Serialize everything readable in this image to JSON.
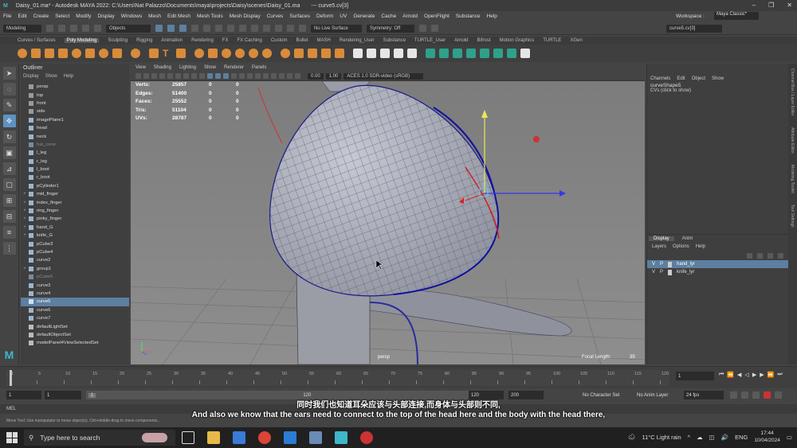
{
  "window": {
    "file": "Daisy_01.ma*",
    "title": "Autodesk MAYA 2022: C:\\Users\\Nat Palazzo\\Documents\\maya\\projects\\Daisy\\scenes\\Daisy_01.ma",
    "tail": "---   curve5.cv[3]"
  },
  "menubar": {
    "items": [
      "File",
      "Edit",
      "Create",
      "Select",
      "Modify",
      "Display",
      "Windows",
      "Mesh",
      "Edit Mesh",
      "Mesh Tools",
      "Mesh Display",
      "Curves",
      "Surfaces",
      "Deform",
      "UV",
      "Generate",
      "Cache",
      "Arnold",
      "OpenFlight",
      "Substance",
      "Help"
    ],
    "workspace_label": "Workspace :",
    "workspace_value": "Maya Classic*"
  },
  "statusline": {
    "menuset": "Modeling",
    "select_mode": "Objects",
    "live_surface": "No Live Surface",
    "symmetry": "Symmetry: Off",
    "name_field": "curve5.cv[3]"
  },
  "shelf_tabs": [
    "Curves / Surfaces",
    "Poly Modeling",
    "Sculpting",
    "Rigging",
    "Animation",
    "Rendering",
    "FX",
    "FX Caching",
    "Custom",
    "Bullet",
    "MASH",
    "Rendering_User",
    "Substance",
    "TURTLE_User",
    "Arnold",
    "Bifrost",
    "Motion Graphics",
    "TURTLE",
    "XGen"
  ],
  "shelf_active": "Poly Modeling",
  "outliner": {
    "title": "Outliner",
    "menu": [
      "Display",
      "Show",
      "Help"
    ],
    "items": [
      {
        "label": "persp",
        "exp": "",
        "dim": false,
        "sel": false,
        "color": "#9a9a9a"
      },
      {
        "label": "top",
        "exp": "",
        "dim": false,
        "sel": false,
        "color": "#9a9a9a"
      },
      {
        "label": "front",
        "exp": "",
        "dim": false,
        "sel": false,
        "color": "#9a9a9a"
      },
      {
        "label": "side",
        "exp": "",
        "dim": false,
        "sel": false,
        "color": "#9a9a9a"
      },
      {
        "label": "imagePlane1",
        "exp": "",
        "dim": false,
        "sel": false,
        "color": "#9ab5cf"
      },
      {
        "label": "head",
        "exp": "",
        "dim": false,
        "sel": false,
        "color": "#9ab5cf"
      },
      {
        "label": "neck",
        "exp": "",
        "dim": false,
        "sel": false,
        "color": "#9ab5cf"
      },
      {
        "label": "hat_cone",
        "exp": "",
        "dim": true,
        "sel": false,
        "color": "#7a8a9a"
      },
      {
        "label": "l_leg",
        "exp": "",
        "dim": false,
        "sel": false,
        "color": "#9ab5cf"
      },
      {
        "label": "r_leg",
        "exp": "",
        "dim": false,
        "sel": false,
        "color": "#9ab5cf"
      },
      {
        "label": "l_boot",
        "exp": "",
        "dim": false,
        "sel": false,
        "color": "#9ab5cf"
      },
      {
        "label": "r_boot",
        "exp": "",
        "dim": false,
        "sel": false,
        "color": "#9ab5cf"
      },
      {
        "label": "pCylinder1",
        "exp": "",
        "dim": false,
        "sel": false,
        "color": "#9ab5cf"
      },
      {
        "label": "mid_finger",
        "exp": "+",
        "dim": false,
        "sel": false,
        "color": "#9ab5cf"
      },
      {
        "label": "index_finger",
        "exp": "+",
        "dim": false,
        "sel": false,
        "color": "#9ab5cf"
      },
      {
        "label": "ring_finger",
        "exp": "+",
        "dim": false,
        "sel": false,
        "color": "#9ab5cf"
      },
      {
        "label": "pinky_finger",
        "exp": "+",
        "dim": false,
        "sel": false,
        "color": "#9ab5cf"
      },
      {
        "label": "hand_G",
        "exp": "+",
        "dim": false,
        "sel": false,
        "color": "#9ab5cf"
      },
      {
        "label": "knife_G",
        "exp": "+",
        "dim": false,
        "sel": false,
        "color": "#9ab5cf"
      },
      {
        "label": "pCube3",
        "exp": "",
        "dim": false,
        "sel": false,
        "color": "#9ab5cf"
      },
      {
        "label": "pCube4",
        "exp": "",
        "dim": false,
        "sel": false,
        "color": "#9ab5cf"
      },
      {
        "label": "curve2",
        "exp": "",
        "dim": false,
        "sel": false,
        "color": "#9ab5cf"
      },
      {
        "label": "group1",
        "exp": "+",
        "dim": false,
        "sel": false,
        "color": "#9ab5cf"
      },
      {
        "label": "pCube5",
        "exp": "",
        "dim": true,
        "sel": false,
        "color": "#7a8a9a"
      },
      {
        "label": "curve3",
        "exp": "",
        "dim": false,
        "sel": false,
        "color": "#9ab5cf"
      },
      {
        "label": "curve4",
        "exp": "",
        "dim": false,
        "sel": false,
        "color": "#9ab5cf"
      },
      {
        "label": "curve5",
        "exp": "",
        "dim": false,
        "sel": true,
        "color": "#cfe0f0"
      },
      {
        "label": "curve6",
        "exp": "",
        "dim": false,
        "sel": false,
        "color": "#9ab5cf"
      },
      {
        "label": "curve7",
        "exp": "",
        "dim": false,
        "sel": false,
        "color": "#9ab5cf"
      },
      {
        "label": "defaultLightSet",
        "exp": "",
        "dim": false,
        "sel": false,
        "color": "#bbbbbb"
      },
      {
        "label": "defaultObjectSet",
        "exp": "",
        "dim": false,
        "sel": false,
        "color": "#bbbbbb"
      },
      {
        "label": "modelPanel4ViewSelectedSet",
        "exp": "",
        "dim": false,
        "sel": false,
        "color": "#bbbbbb"
      }
    ]
  },
  "viewport": {
    "menu": [
      "View",
      "Shading",
      "Lighting",
      "Show",
      "Renderer",
      "Panels"
    ],
    "exposure": "0.00",
    "gamma": "1.00",
    "colorspace": "ACES 1.0 SDR-video (sRGB)",
    "hud": [
      {
        "label": "Verts:",
        "a": "25857",
        "b": "0",
        "c": "0"
      },
      {
        "label": "Edges:",
        "a": "51400",
        "b": "0",
        "c": "0"
      },
      {
        "label": "Faces:",
        "a": "25552",
        "b": "0",
        "c": "0"
      },
      {
        "label": "Tris:",
        "a": "51104",
        "b": "0",
        "c": "0"
      },
      {
        "label": "UVs:",
        "a": "28787",
        "b": "0",
        "c": "0"
      }
    ],
    "camera": "persp",
    "focal_label": "Focal Length:",
    "focal_value": "35"
  },
  "channelbox": {
    "menu": [
      "Channels",
      "Edit",
      "Object",
      "Show"
    ],
    "object": "curveShape5",
    "hint": "CVs (click to show)"
  },
  "layers": {
    "tabs": [
      "Display",
      "Anim"
    ],
    "menu": [
      "Layers",
      "Options",
      "Help"
    ],
    "rows": [
      {
        "name": "hand_lyr",
        "sel": true
      },
      {
        "name": "knife_lyr",
        "sel": false
      }
    ]
  },
  "side_tabs": [
    "Channel Box / Layer Editor",
    "Attribute Editor",
    "Modeling Toolkit",
    "Tool Settings"
  ],
  "timeslider": {
    "ticks": [
      "1",
      "5",
      "10",
      "15",
      "20",
      "25",
      "30",
      "35",
      "40",
      "45",
      "50",
      "55",
      "60",
      "65",
      "70",
      "75",
      "80",
      "85",
      "90",
      "95",
      "100",
      "105",
      "110",
      "115",
      "120"
    ],
    "current_frame": "1"
  },
  "range": {
    "start": "1",
    "inner_start": "1",
    "handle": "1",
    "inner_end": "120",
    "end_inner": "120",
    "end": "200",
    "character_set": "No Character Set",
    "anim_layer": "No Anim Layer",
    "fps": "24 fps"
  },
  "cmdline": {
    "label": "MEL",
    "help": "Move Tool: Use manipulator to move object(s). Ctrl+middle-drag to move components..."
  },
  "subtitles": {
    "zh": "同时我们也知道耳朵应该与头部连接,而身体与头部则不同,",
    "en": "And also we know that the ears need to connect to the top of the head here and the body with the head there,"
  },
  "taskbar": {
    "search_placeholder": "Type here to search",
    "weather": "11°C  Light rain",
    "lang": "ENG",
    "time": "17:44",
    "date": "10/04/2024"
  }
}
